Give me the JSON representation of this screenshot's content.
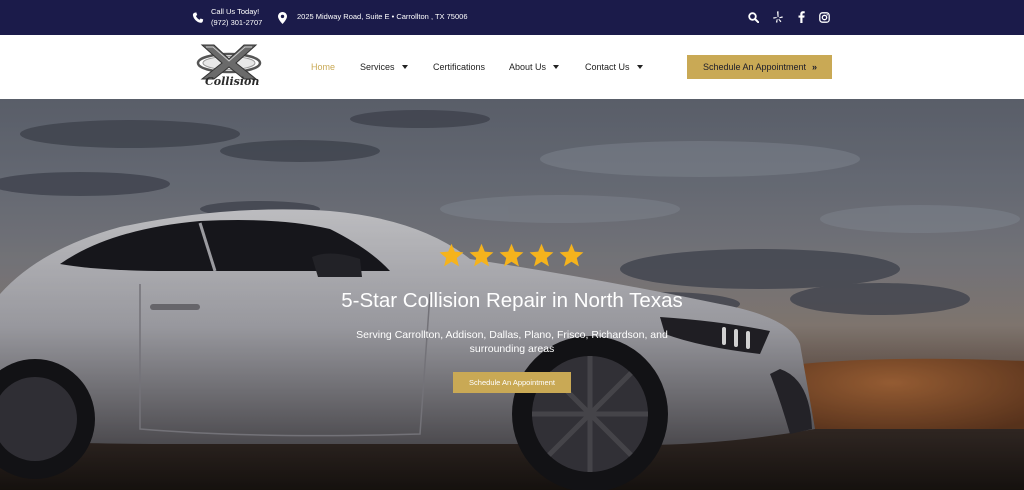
{
  "topbar": {
    "call_label": "Call Us Today!",
    "call_number": "(972) 301-2707",
    "address": "2025 Midway Road, Suite E • Carrollton , TX 75006",
    "icons": [
      "phone-icon",
      "map-pin-icon",
      "search-icon",
      "yelp-icon",
      "facebook-icon",
      "instagram-icon"
    ]
  },
  "brand": {
    "logo_text": "Collision"
  },
  "nav": {
    "items": [
      {
        "label": "Home",
        "active": true
      },
      {
        "label": "Services",
        "dropdown": true
      },
      {
        "label": "Certifications"
      },
      {
        "label": "About Us",
        "dropdown": true
      },
      {
        "label": "Contact Us",
        "dropdown": true
      }
    ],
    "cta_label": "Schedule An Appointment"
  },
  "hero": {
    "rating_stars": 5,
    "title": "5-Star Collision Repair in North Texas",
    "subtitle": "Serving Carrollton, Addison, Dallas, Plano, Frisco, Richardson, and surrounding areas",
    "cta_label": "Schedule An Appointment"
  },
  "colors": {
    "topbar_bg": "#1b1b4a",
    "accent_gold": "#c9a955",
    "star_color": "#f5b31c"
  }
}
